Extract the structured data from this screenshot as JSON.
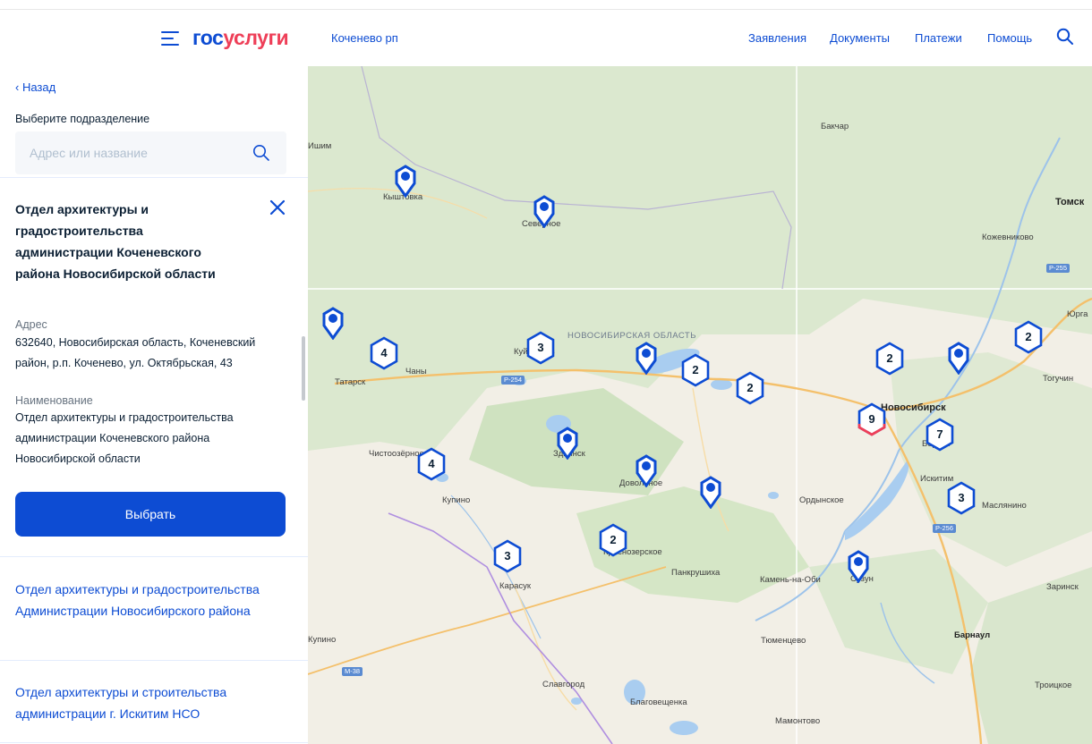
{
  "header": {
    "logo_part1": "гос",
    "logo_part2": "услуги",
    "location": "Коченево рп",
    "nav": [
      "Заявления",
      "Документы",
      "Платежи",
      "Помощь"
    ]
  },
  "panel": {
    "back": "‹ Назад",
    "subtitle": "Выберите подразделение",
    "search_placeholder": "Адрес или название",
    "selected": {
      "title": "Отдел архитектуры и градостроительства администрации Коченевского района Новосибирской области",
      "address_label": "Адрес",
      "address": "632640, Новосибирская область, Коченевский район, р.п. Коченево, ул. Октябрьская, 43",
      "name_label": "Наименование",
      "name": "Отдел архитектуры и градостроительства администрации Коченевского района Новосибирской области",
      "button": "Выбрать"
    },
    "list": [
      "Отдел архитектуры и градостроительства Администрации Новосибирского района",
      "Отдел архитектуры и строительства администрации г. Искитим НСО"
    ]
  },
  "map": {
    "region_label": "НОВОСИБИРСКАЯ ОБЛАСТЬ",
    "towns": [
      "Бакчар",
      "Томск",
      "Кожевниково",
      "Юрга",
      "Тогучин",
      "Новосибирск",
      "Бердск",
      "Искитим",
      "Маслянино",
      "Ордынское",
      "Камень-на-Оби",
      "Сузун",
      "Заринск",
      "Барнаул",
      "Троицкое",
      "Тюменцево",
      "Мамонтово",
      "Славгород",
      "Благовещенка",
      "Карасук",
      "Краснозерское",
      "Панкрушиха",
      "Купино",
      "Чистоозёрное",
      "Здвинск",
      "Довольное",
      "Татарск",
      "Чаны",
      "Куйбышев",
      "Кыштовка",
      "Северное",
      "Ишим",
      "Купино"
    ],
    "road_labels": [
      "Р-255",
      "Р-254",
      "Р-256",
      "М-38"
    ],
    "clusters": [
      "4",
      "3",
      "2",
      "2",
      "2",
      "2",
      "9",
      "7",
      "3",
      "4",
      "2",
      "3"
    ],
    "accent_blue": "#0d4cd3",
    "accent_red": "#ee3f58"
  }
}
